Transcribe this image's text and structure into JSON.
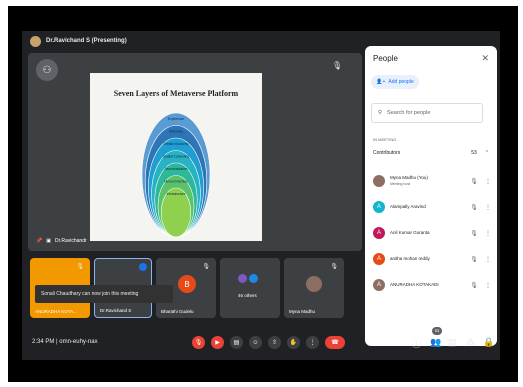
{
  "presenter_bar": {
    "title": "Dr.Ravichand S (Presenting)"
  },
  "stage": {
    "logo_icon": "meet-logo-icon",
    "presenter_label": "Dr.Ravichandr"
  },
  "slide": {
    "title": "Seven Layers of Metaverse Platform",
    "layers": [
      "Experience",
      "Discovery",
      "Creator Economy",
      "Spatial Computing",
      "Decentralization",
      "Human Interface",
      "Infrastructure"
    ],
    "colors": [
      "#5b9bd5",
      "#2e75b6",
      "#1f9ed1",
      "#27b3c4",
      "#2db89a",
      "#5cc26a",
      "#8fd14f"
    ]
  },
  "tiles": [
    {
      "label": "ANURADHA KOTA...",
      "bg": "#f29900"
    },
    {
      "label": "Dr.Ravichand S",
      "bg": "#3c4043"
    },
    {
      "label": "Bharathi Gudelu",
      "initial": "B",
      "bg": "#3c4043"
    },
    {
      "label": "46 others",
      "bg": "#3c4043"
    },
    {
      "label": "Myna Madhu",
      "bg": "#3c4043"
    }
  ],
  "toast": "Sonali Chaudhary can now join this meeting",
  "people": {
    "title": "People",
    "add_label": "Add people",
    "search_placeholder": "Search for people",
    "section": "IN MEETING",
    "contributors_label": "Contributors",
    "contributors_count": "53",
    "rows": [
      {
        "name": "Myna Madhu (You)",
        "sub": "Meeting host",
        "initial": "",
        "color": "#8d6e63"
      },
      {
        "name": "Alampally Aravind",
        "sub": "",
        "initial": "A",
        "color": "#12b5cb"
      },
      {
        "name": "Anil Kumar Goranta",
        "sub": "",
        "initial": "A",
        "color": "#c2185b"
      },
      {
        "name": "anitha mohan reddy",
        "sub": "",
        "initial": "A",
        "color": "#e64a19"
      },
      {
        "name": "ANURADHA KOTAKADI",
        "sub": "",
        "initial": "A",
        "color": "#8d6e63"
      }
    ]
  },
  "bottom": {
    "time_code": "2:34 PM  |  omn-euhy-nax",
    "people_badge": "53"
  }
}
